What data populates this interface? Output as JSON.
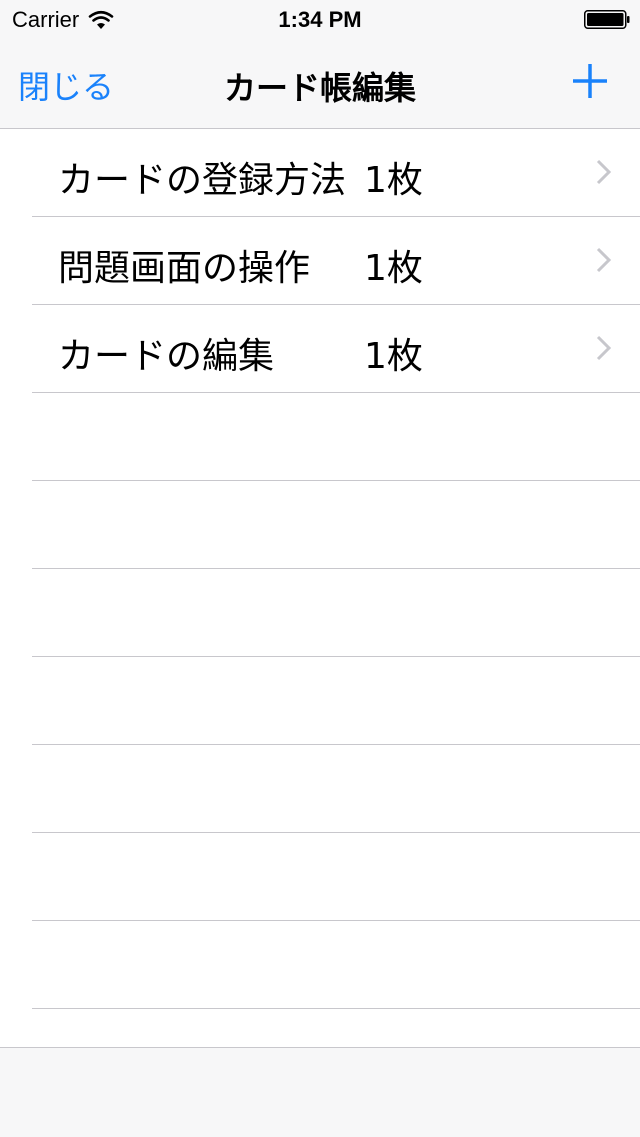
{
  "status_bar": {
    "carrier": "Carrier",
    "time": "1:34 PM",
    "wifi_icon": "wifi-icon",
    "battery_icon": "battery-icon"
  },
  "nav": {
    "close_label": "閉じる",
    "title": "カード帳編集",
    "add_icon": "plus-icon",
    "accent_color": "#1a82fb"
  },
  "rows": [
    {
      "title": "カードの登録方法",
      "count": "1枚"
    },
    {
      "title": "問題画面の操作",
      "count": "1枚"
    },
    {
      "title": "カードの編集",
      "count": "1枚"
    }
  ],
  "chevron_icon": "chevron-right-icon"
}
